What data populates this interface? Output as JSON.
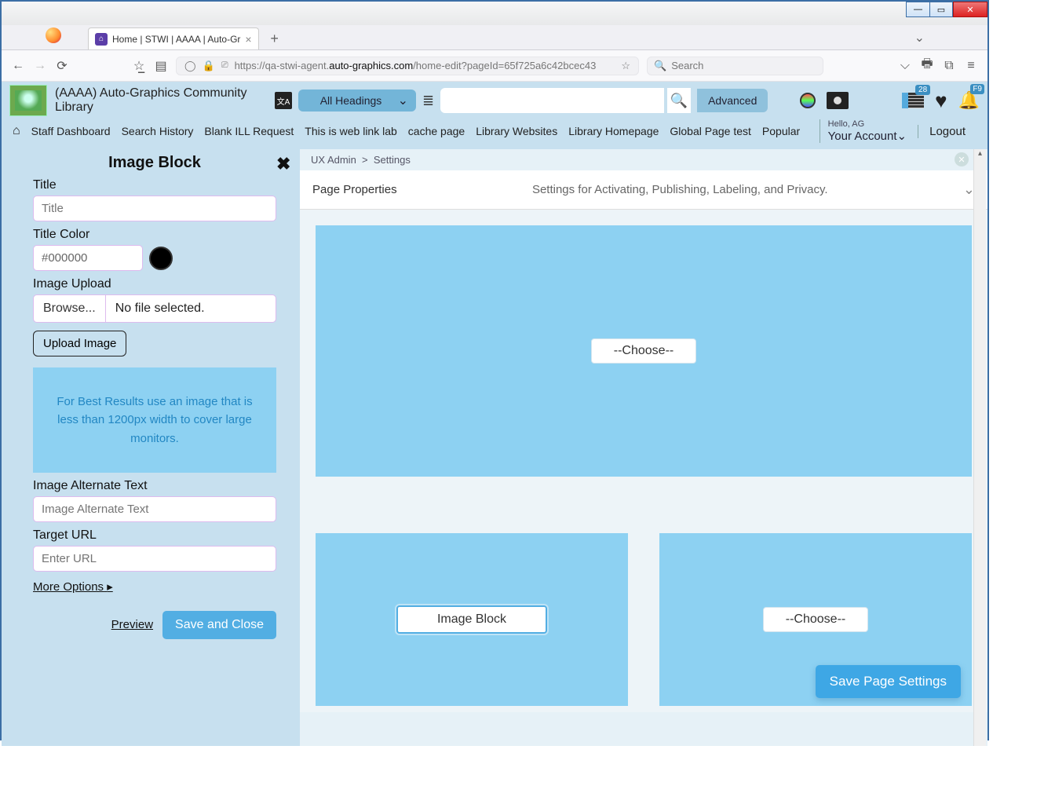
{
  "window": {
    "tab_title": "Home | STWI | AAAA | Auto-Gr"
  },
  "browser": {
    "url_prefix": "https://qa-stwi-agent.",
    "url_domain": "auto-graphics.com",
    "url_path": "/home-edit?pageId=65f725a6c42bcec43",
    "search_placeholder": "Search"
  },
  "header": {
    "library_name": "(AAAA) Auto-Graphics Community Library",
    "heading_select": "All Headings",
    "advanced": "Advanced",
    "badge_count": "28",
    "f9": "F9"
  },
  "account": {
    "hello": "Hello, AG",
    "your_account": "Your Account",
    "logout": "Logout"
  },
  "nav": {
    "items": [
      "Staff Dashboard",
      "Search History",
      "Blank ILL Request",
      "This is web link lab",
      "cache page",
      "Library Websites",
      "Library Homepage",
      "Global Page test",
      "Popular"
    ]
  },
  "sidebar": {
    "title": "Image Block",
    "title_label": "Title",
    "title_placeholder": "Title",
    "title_color_label": "Title Color",
    "title_color_value": "#000000",
    "image_upload_label": "Image Upload",
    "browse": "Browse...",
    "no_file": "No file selected.",
    "upload_btn": "Upload Image",
    "tip": "For Best Results use an image that is less than 1200px width to cover large monitors.",
    "alt_label": "Image Alternate Text",
    "alt_placeholder": "Image Alternate Text",
    "target_label": "Target URL",
    "target_placeholder": "Enter URL",
    "more_options": "More Options",
    "preview": "Preview",
    "save_close": "Save and Close"
  },
  "main": {
    "breadcrumb_a": "UX Admin",
    "breadcrumb_b": "Settings",
    "page_properties": "Page Properties",
    "page_properties_desc": "Settings for Activating, Publishing, Labeling, and Privacy.",
    "slot_big": "--Choose--",
    "slot_left": "Image Block",
    "slot_right": "--Choose--",
    "save_page": "Save Page Settings"
  }
}
